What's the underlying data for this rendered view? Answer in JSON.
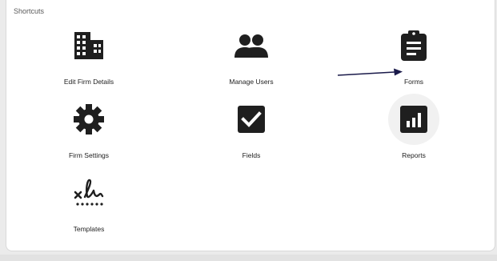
{
  "section": {
    "title": "Shortcuts"
  },
  "shortcuts": [
    {
      "label": "Edit Firm Details",
      "icon": "building-icon"
    },
    {
      "label": "Manage Users",
      "icon": "users-icon"
    },
    {
      "label": "Forms",
      "icon": "clipboard-icon"
    },
    {
      "label": "Firm Settings",
      "icon": "gear-icon"
    },
    {
      "label": "Fields",
      "icon": "checkbox-icon"
    },
    {
      "label": "Reports",
      "icon": "bar-chart-icon"
    },
    {
      "label": "Templates",
      "icon": "signature-icon"
    }
  ],
  "colors": {
    "icon": "#1f1f1f",
    "arrow": "#1a1a4a",
    "hover_circle": "#f1f1f1"
  }
}
